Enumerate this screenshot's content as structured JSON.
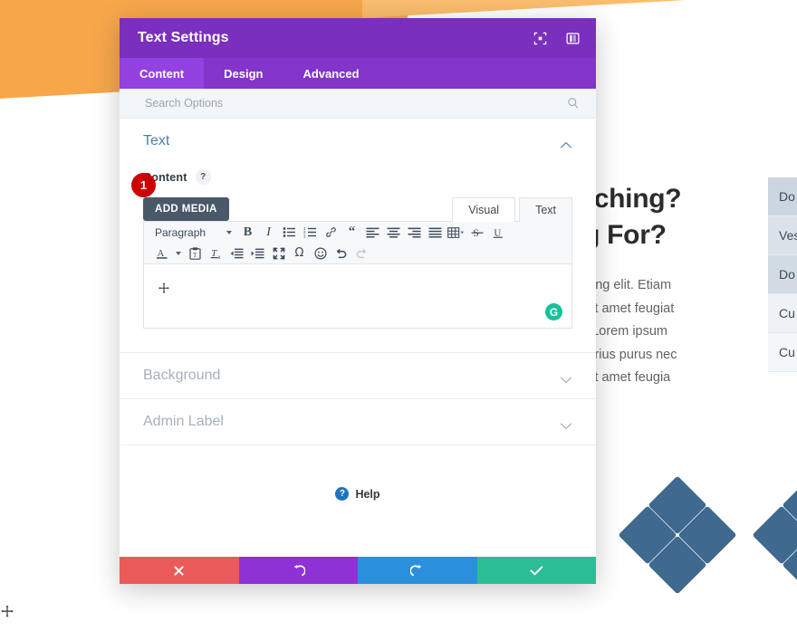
{
  "colors": {
    "modal_header_purple": "#7b2fbe",
    "modal_tabbar_purple": "#8334c9",
    "modal_tab_active_purple": "#9341e0",
    "banner_orange": "#f7a74a",
    "badge_red": "#cc0000",
    "btn_close_red": "#eb5a5a",
    "btn_undo_purple": "#8e32d6",
    "btn_redo_blue": "#2a8fdd",
    "btn_save_green": "#2bbd96",
    "grammarly_green": "#15c39a",
    "diamond_blue": "#3f698e",
    "section_open_blue": "#4c7eaa",
    "section_closed_gray": "#a7b0ba",
    "add_media_slate": "#495969"
  },
  "modal": {
    "title": "Text Settings",
    "titlebar_icons": [
      {
        "name": "focus-mode-icon",
        "label": "Focus Mode"
      },
      {
        "name": "panel-layout-icon",
        "label": "Panel Layout"
      }
    ],
    "tabs": [
      {
        "label": "Content",
        "active": true
      },
      {
        "label": "Design",
        "active": false
      },
      {
        "label": "Advanced",
        "active": false
      }
    ],
    "search": {
      "placeholder": "Search Options",
      "value": ""
    },
    "sections": [
      {
        "label": "Text",
        "open": true
      },
      {
        "label": "Background",
        "open": false
      },
      {
        "label": "Admin Label",
        "open": false
      }
    ],
    "content_field": {
      "label": "Content",
      "help_glyph": "?",
      "add_media_label": "ADD MEDIA",
      "view_tabs": [
        {
          "label": "Visual",
          "active": true
        },
        {
          "label": "Text",
          "active": false
        }
      ],
      "editor_value": "",
      "grammarly_glyph": "G",
      "format_select_label": "Paragraph"
    },
    "toolbar_row1": [
      {
        "name": "bold-icon",
        "label": "Bold"
      },
      {
        "name": "italic-icon",
        "label": "Italic"
      },
      {
        "name": "bulleted-list-icon",
        "label": "Bulleted list"
      },
      {
        "name": "numbered-list-icon",
        "label": "Numbered list"
      },
      {
        "name": "link-icon",
        "label": "Insert link"
      },
      {
        "name": "blockquote-icon",
        "label": "Blockquote"
      },
      {
        "name": "align-left-icon",
        "label": "Align left"
      },
      {
        "name": "align-center-icon",
        "label": "Align center"
      },
      {
        "name": "align-right-icon",
        "label": "Align right"
      },
      {
        "name": "align-justify-icon",
        "label": "Justify"
      },
      {
        "name": "table-icon",
        "label": "Table"
      },
      {
        "name": "strikethrough-icon",
        "label": "Strikethrough"
      },
      {
        "name": "underline-icon",
        "label": "Underline"
      }
    ],
    "toolbar_row2": [
      {
        "name": "text-color-icon",
        "label": "Text color"
      },
      {
        "name": "paste-as-text-icon",
        "label": "Paste as text"
      },
      {
        "name": "clear-formatting-icon",
        "label": "Clear formatting"
      },
      {
        "name": "outdent-icon",
        "label": "Decrease indent"
      },
      {
        "name": "indent-icon",
        "label": "Increase indent"
      },
      {
        "name": "fullscreen-icon",
        "label": "Fullscreen"
      },
      {
        "name": "special-character-icon",
        "label": "Special character"
      },
      {
        "name": "emoji-icon",
        "label": "Emoji"
      },
      {
        "name": "undo-icon",
        "label": "Undo"
      },
      {
        "name": "redo-icon",
        "label": "Redo"
      }
    ],
    "help": {
      "label": "Help",
      "icon_glyph": "?"
    },
    "footer_buttons": [
      {
        "name": "discard-button",
        "label": "Discard changes",
        "glyph": "close-icon"
      },
      {
        "name": "undo-button",
        "label": "Undo",
        "glyph": "undo-icon"
      },
      {
        "name": "redo-button",
        "label": "Redo",
        "glyph": "redo-icon"
      },
      {
        "name": "save-button",
        "label": "Save changes",
        "glyph": "check-icon"
      }
    ]
  },
  "annotation": {
    "badge_number": "1"
  },
  "page_background": {
    "heading_line1": "Coaching?",
    "heading_line2": "hing For?",
    "paragraph_lines": [
      "r adipiscing elit. Etiam",
      "ndisse sit amet feugiat",
      "sagittis. Lorem ipsum",
      "Etiam varius purus nec",
      "ndisse sit amet feugia"
    ],
    "list_items": [
      "Do",
      "Ves",
      "Do",
      "Cu",
      "Cu"
    ]
  }
}
